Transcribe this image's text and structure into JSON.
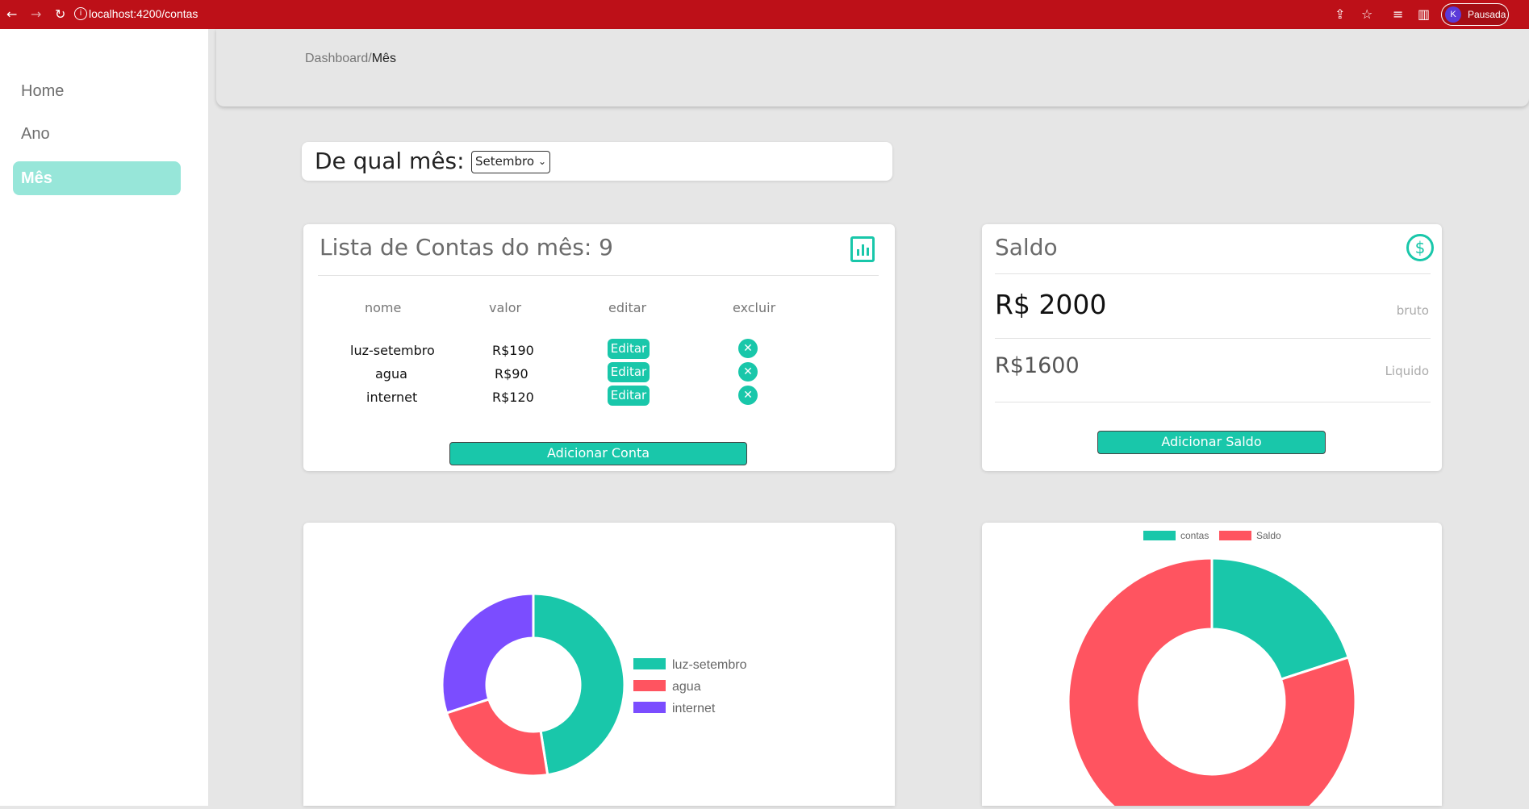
{
  "browser": {
    "url": "localhost:4200/contas",
    "profile_initial": "K",
    "profile_status": "Pausada"
  },
  "sidebar": {
    "items": [
      {
        "label": "Home"
      },
      {
        "label": "Ano"
      },
      {
        "label": "Mês"
      }
    ]
  },
  "breadcrumb": {
    "parent": "Dashboard/",
    "current": "Mês"
  },
  "month_selector": {
    "label": "De qual mês:",
    "selected": "Setembro"
  },
  "contas": {
    "title": "Lista de Contas do mês: 9",
    "columns": [
      "nome",
      "valor",
      "editar",
      "excluir"
    ],
    "rows": [
      {
        "nome": "luz-setembro",
        "valor": "R$190",
        "edit_label": "Editar"
      },
      {
        "nome": "agua",
        "valor": "R$90",
        "edit_label": "Editar"
      },
      {
        "nome": "internet",
        "valor": "R$120",
        "edit_label": "Editar"
      }
    ],
    "add_button": "Adicionar Conta"
  },
  "saldo": {
    "title": "Saldo",
    "bruto_value": "R$ 2000",
    "bruto_label": "bruto",
    "liquido_value": "R$1600",
    "liquido_label": "Liquido",
    "add_button": "Adicionar Saldo"
  },
  "colors": {
    "accent": "#19c7aa",
    "red": "#ff5460",
    "purple": "#7b4dff",
    "browser": "#bd1018"
  },
  "chart_data": [
    {
      "type": "pie",
      "subtype": "doughnut",
      "categories": [
        "luz-setembro",
        "agua",
        "internet"
      ],
      "values": [
        190,
        90,
        120
      ],
      "colors": [
        "#19c7aa",
        "#ff5460",
        "#7b4dff"
      ],
      "legend": "right"
    },
    {
      "type": "pie",
      "subtype": "doughnut",
      "categories": [
        "contas",
        "Saldo"
      ],
      "values": [
        400,
        1600
      ],
      "colors": [
        "#19c7aa",
        "#ff5460"
      ],
      "legend": "top"
    }
  ]
}
